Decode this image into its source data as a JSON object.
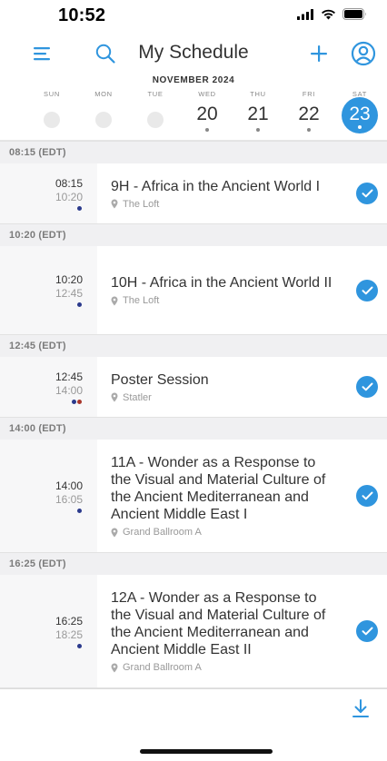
{
  "status": {
    "time": "10:52"
  },
  "nav": {
    "title": "My Schedule"
  },
  "calendar": {
    "month": "NOVEMBER 2024",
    "days": [
      {
        "name": "SUN",
        "num": ""
      },
      {
        "name": "MON",
        "num": ""
      },
      {
        "name": "TUE",
        "num": ""
      },
      {
        "name": "WED",
        "num": "20"
      },
      {
        "name": "THU",
        "num": "21"
      },
      {
        "name": "FRI",
        "num": "22"
      },
      {
        "name": "SAT",
        "num": "23"
      }
    ],
    "selected": "23"
  },
  "groups": [
    {
      "header": "08:15 (EDT)",
      "event": {
        "start": "08:15",
        "end": "10:20",
        "title": "9H - Africa in the Ancient World I",
        "location": "The Loft",
        "dots": [
          "#2b3a8c"
        ],
        "checked": true
      }
    },
    {
      "header": "10:20 (EDT)",
      "event": {
        "start": "10:20",
        "end": "12:45",
        "title": "10H - Africa in the Ancient World II",
        "location": "The Loft",
        "dots": [
          "#2b3a8c"
        ],
        "checked": true
      }
    },
    {
      "header": "12:45 (EDT)",
      "event": {
        "start": "12:45",
        "end": "14:00",
        "title": "Poster Session",
        "location": "Statler",
        "dots": [
          "#2b3a8c",
          "#a8362c"
        ],
        "checked": true
      }
    },
    {
      "header": "14:00 (EDT)",
      "event": {
        "start": "14:00",
        "end": "16:05",
        "title": "11A - Wonder as a Response to the Visual and Material Culture of the Ancient Mediterranean and Ancient Middle East I",
        "location": "Grand Ballroom A",
        "dots": [
          "#2b3a8c"
        ],
        "checked": true
      }
    },
    {
      "header": "16:25 (EDT)",
      "event": {
        "start": "16:25",
        "end": "18:25",
        "title": "12A - Wonder as a Response to the Visual and Material Culture of the Ancient Mediterranean and Ancient Middle East II",
        "location": "Grand Ballroom A",
        "dots": [
          "#2b3a8c"
        ],
        "checked": true
      }
    }
  ],
  "colors": {
    "accent": "#2f95de"
  },
  "icons": [
    "menu-icon",
    "search-icon",
    "plus-icon",
    "user-circle-icon",
    "location-pin-icon",
    "check-icon",
    "download-icon"
  ]
}
